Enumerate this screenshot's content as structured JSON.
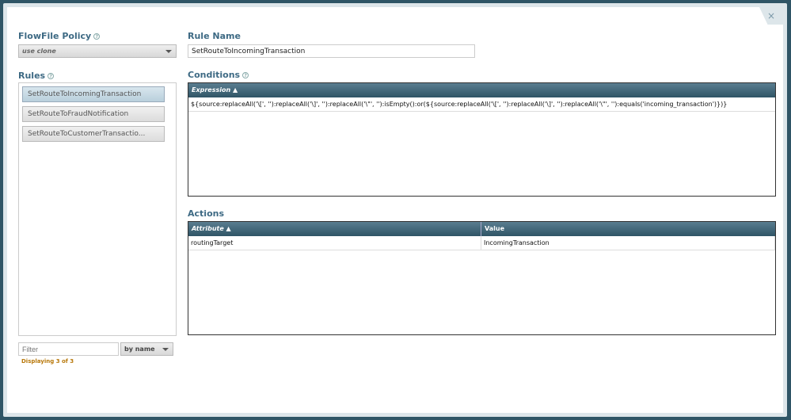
{
  "flowfile_policy": {
    "label": "FlowFile Policy",
    "value": "use clone"
  },
  "rules": {
    "label": "Rules",
    "items": [
      "SetRouteToIncomingTransaction",
      "SetRouteToFraudNotification",
      "SetRouteToCustomerTransactio..."
    ],
    "filter_placeholder": "Filter",
    "filter_by": "by name",
    "status": "Displaying 3 of 3"
  },
  "rule_name": {
    "label": "Rule Name",
    "value": "SetRouteToIncomingTransaction"
  },
  "conditions": {
    "label": "Conditions",
    "header": "Expression ▲",
    "rows": [
      "${source:replaceAll('\\[', ''):replaceAll('\\]', ''):replaceAll('\\\"', ''):isEmpty():or(${source:replaceAll('\\[', ''):replaceAll('\\]', ''):replaceAll('\\\"', ''):equals('incoming_transaction')})}"
    ]
  },
  "actions": {
    "label": "Actions",
    "headers": [
      "Attribute ▲",
      "Value"
    ],
    "rows": [
      [
        "routingTarget",
        "IncomingTransaction"
      ]
    ]
  },
  "close": "×"
}
